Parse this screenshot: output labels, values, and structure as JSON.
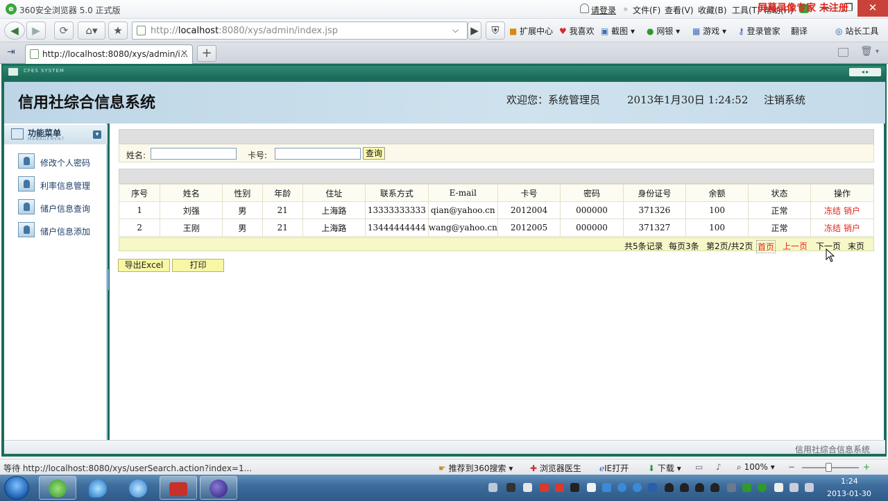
{
  "browser": {
    "title": "360安全浏览器 5.0 正式版",
    "login_link": "请登录",
    "menu": [
      "文件(F)",
      "查看(V)",
      "收藏(B)",
      "工具(T)",
      "帮助(H)"
    ],
    "url_prefix": "http://",
    "url_host": "localhost",
    "url_rest": ":8080/xys/admin/index.jsp",
    "toolbar": [
      "扩展中心",
      "我喜欢",
      "截图",
      "网银",
      "游戏",
      "登录管家",
      "翻译",
      "站长工具"
    ],
    "watermark": "屏幕录像专家 未注册",
    "tab_title": "http://localhost:8080/xys/admin/i...",
    "status_text": "等待 http://localhost:8080/xys/userSearch.action?index=1...",
    "status_items": [
      "推荐到360搜索",
      "浏览器医生",
      "IE打开",
      "下载"
    ],
    "zoom": "100%"
  },
  "page": {
    "frame_label": "CFES SYSTEM",
    "site_title": "信用社综合信息系统",
    "welcome": "欢迎您：系统管理员",
    "datetime": "2013年1月30日  1:24:52",
    "logout": "注销系统",
    "footer": "信用社综合信息系统"
  },
  "sidebar": {
    "title": "功能菜单",
    "subtitle": "MANAGEMENT",
    "items": [
      "修改个人密码",
      "利率信息管理",
      "储户信息查询",
      "储户信息添加"
    ]
  },
  "search": {
    "name_label": "姓名:",
    "card_label": "卡号:",
    "name_value": "",
    "card_value": "",
    "button": "查询"
  },
  "table": {
    "columns": [
      "序号",
      "姓名",
      "性别",
      "年龄",
      "住址",
      "联系方式",
      "E-mail",
      "卡号",
      "密码",
      "身份证号",
      "余额",
      "状态",
      "操作"
    ],
    "rows": [
      [
        "1",
        "刘强",
        "男",
        "21",
        "上海路",
        "13333333333",
        "qian@yahoo.cn",
        "2012004",
        "000000",
        "371326",
        "100",
        "正常"
      ],
      [
        "2",
        "王刚",
        "男",
        "21",
        "上海路",
        "13444444444",
        "wang@yahoo.cn",
        "2012005",
        "000000",
        "371327",
        "100",
        "正常"
      ]
    ],
    "actions": [
      "冻结",
      "销户"
    ]
  },
  "pager": {
    "total": "共5条记录",
    "per_page": "每页3条",
    "page_info": "第2页/共2页",
    "first": "首页",
    "prev": "上一页",
    "next": "下一页",
    "last": "末页"
  },
  "buttons": {
    "export": "导出Excel",
    "print": "打印"
  },
  "taskbar": {
    "time": "1:24",
    "date": "2013-01-30"
  },
  "colors": {
    "accent_red": "#e4241b",
    "frame_green": "#1b6d5a",
    "header_blue": "#c5dbe9",
    "button_yellow": "#f7f7a4"
  }
}
